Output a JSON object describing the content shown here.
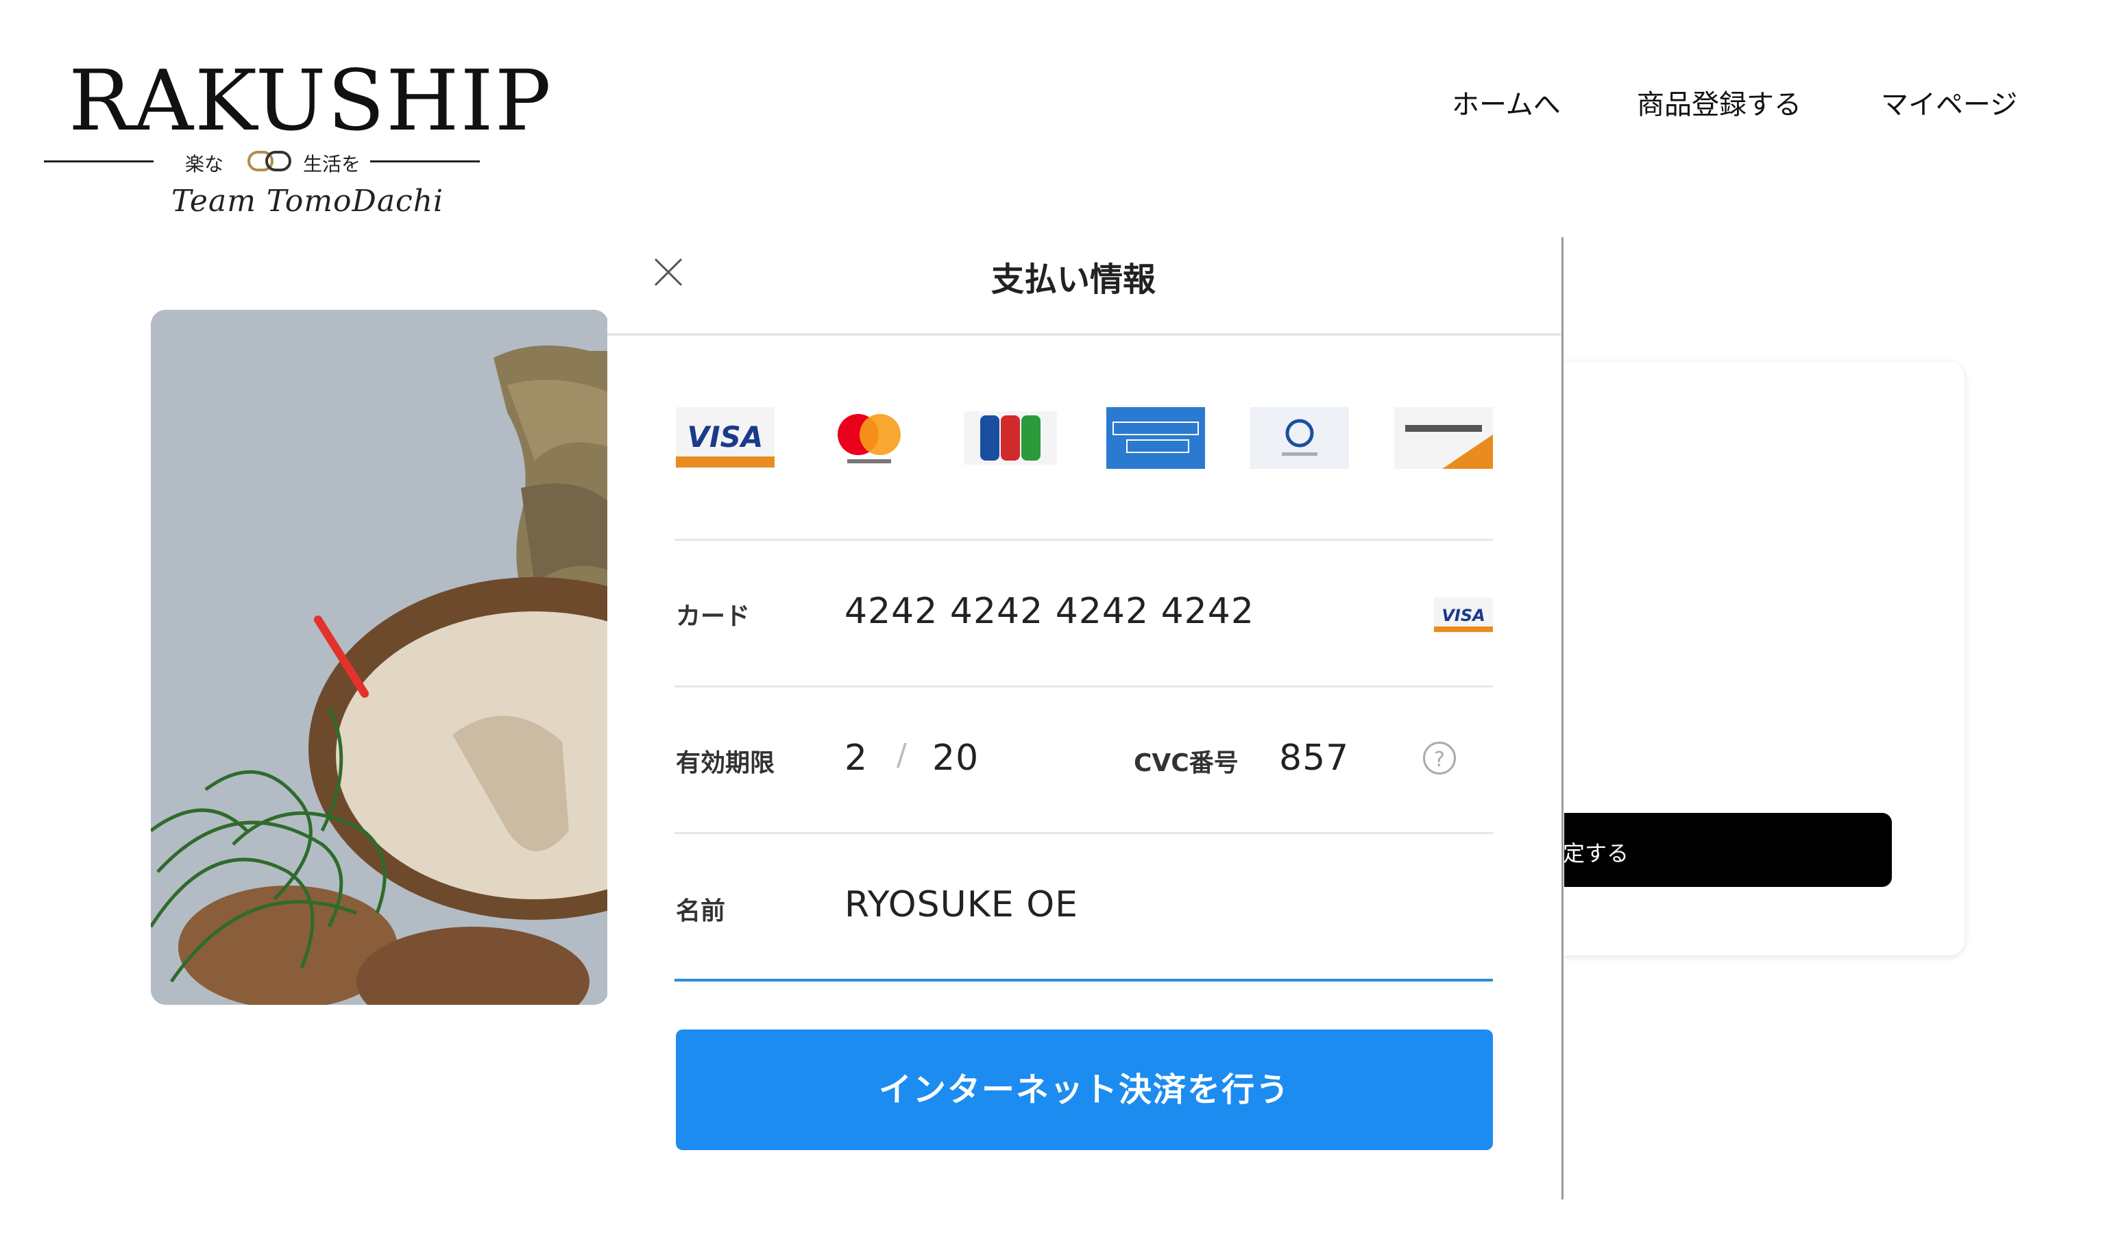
{
  "header": {
    "logo": {
      "main_text": "RAKUSHIP",
      "sub_left": "楽な",
      "sub_right": "生活を",
      "script_text": "Team TomoDachi"
    },
    "nav": [
      {
        "label": "ホームへ"
      },
      {
        "label": "商品登録する"
      },
      {
        "label": "マイページ"
      }
    ]
  },
  "side_card": {
    "confirm_button_label": "定する"
  },
  "modal": {
    "title": "支払い情報",
    "card_brands": [
      "visa-logo",
      "mastercard-logo",
      "jcb-logo",
      "amex-logo",
      "diners-logo",
      "discover-logo"
    ],
    "card_field": {
      "label": "カード",
      "value": "4242 4242 4242 4242",
      "brand": "VISA"
    },
    "expiry_field": {
      "label": "有効期限",
      "month": "2",
      "separator": "/",
      "year": "20"
    },
    "cvc_field": {
      "label": "CVC番号",
      "value": "857",
      "help": "?"
    },
    "name_field": {
      "label": "名前",
      "value": "RYOSUKE OE"
    },
    "pay_button_label": "インターネット決済を行う"
  },
  "colors": {
    "accent_blue": "#1d8cf0",
    "underline_blue": "#2b8fd6",
    "confirm_black": "#000000"
  }
}
